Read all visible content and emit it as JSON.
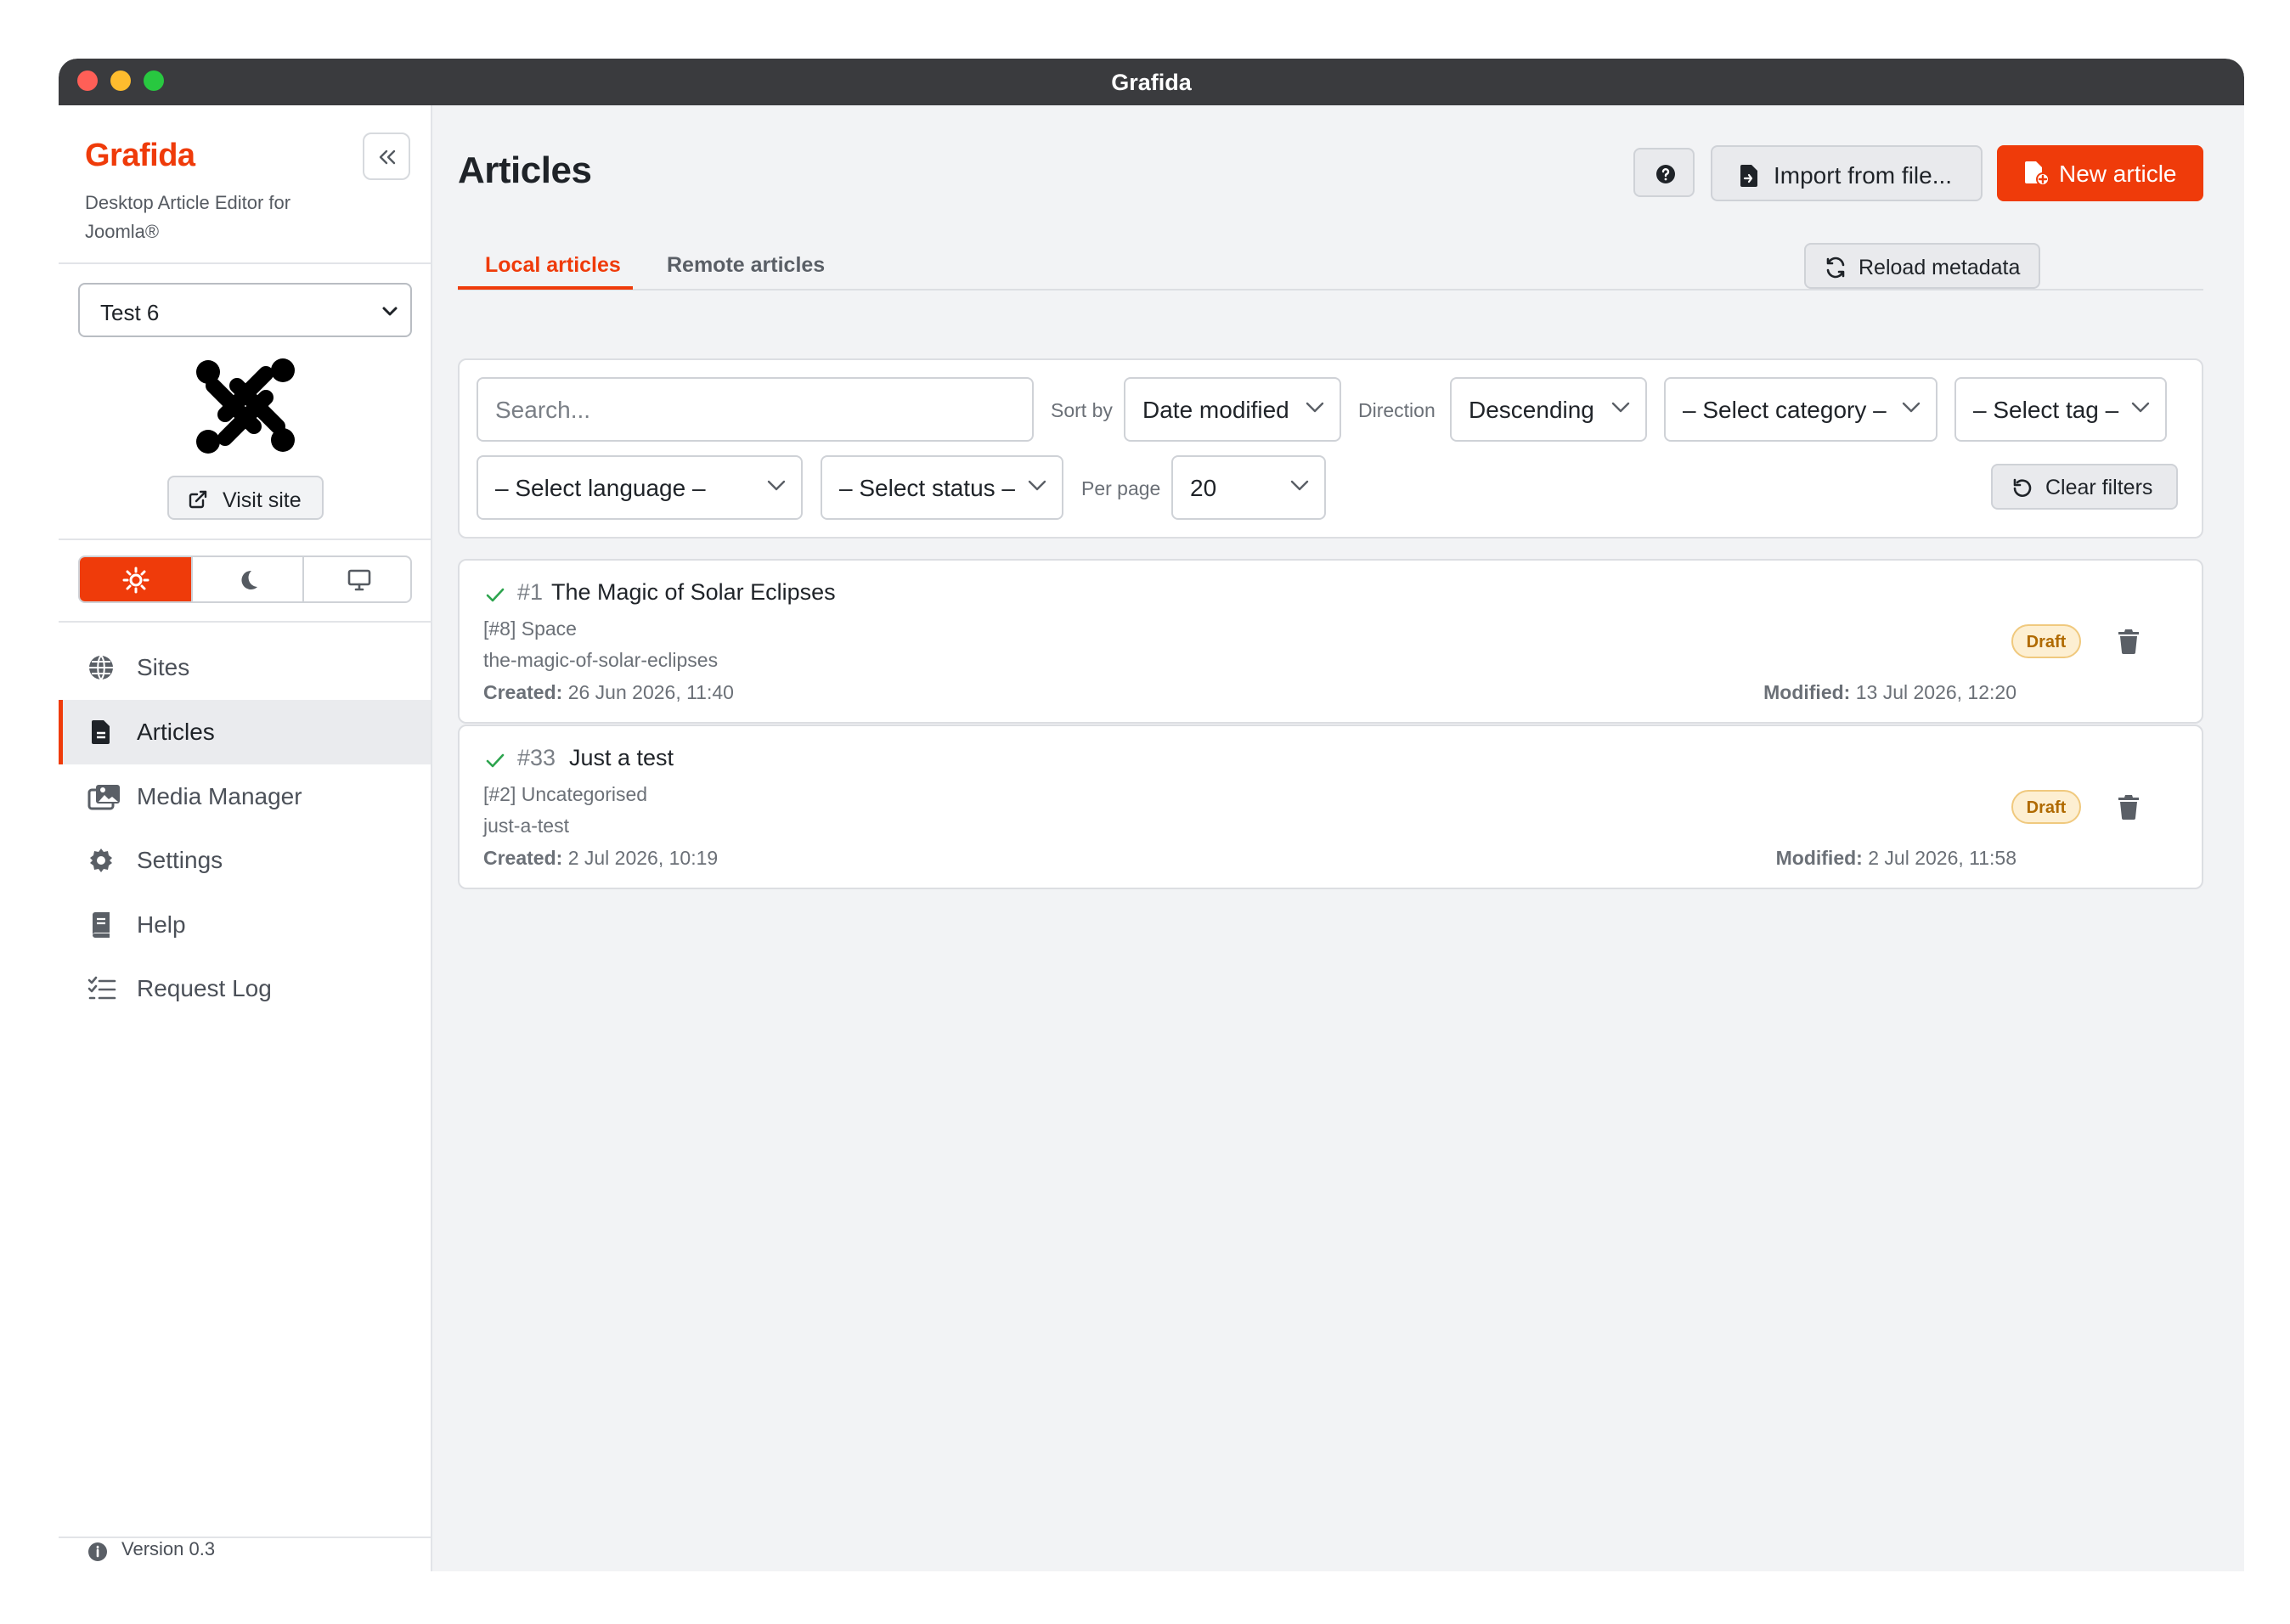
{
  "window": {
    "title": "Grafida"
  },
  "sidebar": {
    "brand": "Grafida",
    "tagline": "Desktop Article Editor for Joomla®",
    "site_select": {
      "value": "Test 6"
    },
    "visit_site_label": "Visit site",
    "theme": {
      "options": [
        "light",
        "dark",
        "system"
      ],
      "selected": "light"
    },
    "nav": [
      {
        "label": "Sites",
        "icon": "globe-icon"
      },
      {
        "label": "Articles",
        "icon": "document-icon",
        "active": true
      },
      {
        "label": "Media Manager",
        "icon": "images-icon"
      },
      {
        "label": "Settings",
        "icon": "gear-icon"
      },
      {
        "label": "Help",
        "icon": "book-icon"
      },
      {
        "label": "Request Log",
        "icon": "list-check-icon"
      }
    ],
    "version": "Version 0.3"
  },
  "main": {
    "title": "Articles",
    "import_label": "Import from file...",
    "new_label": "New article",
    "tabs": [
      {
        "label": "Local articles",
        "active": true
      },
      {
        "label": "Remote articles",
        "active": false
      }
    ],
    "reload_label": "Reload metadata",
    "filters": {
      "search_placeholder": "Search...",
      "sort_by_label": "Sort by",
      "sort_by_value": "Date modified",
      "direction_label": "Direction",
      "direction_value": "Descending",
      "category_value": "– Select category –",
      "tag_value": "– Select tag –",
      "language_value": "– Select language –",
      "status_value": "– Select status –",
      "per_page_label": "Per page",
      "per_page_value": "20",
      "clear_label": "Clear filters"
    },
    "articles": [
      {
        "id": "#1",
        "title": "The Magic of Solar Eclipses",
        "category": "[#8] Space",
        "alias": "the-magic-of-solar-eclipses",
        "created_label": "Created:",
        "created": "26 Jun 2026, 11:40",
        "modified_label": "Modified:",
        "modified": "13 Jul 2026, 12:20",
        "status": "Draft"
      },
      {
        "id": "#33",
        "title": "Just a test",
        "category": "[#2] Uncategorised",
        "alias": "just-a-test",
        "created_label": "Created:",
        "created": "2 Jul 2026, 10:19",
        "modified_label": "Modified:",
        "modified": "2 Jul 2026, 11:58",
        "status": "Draft"
      }
    ]
  },
  "colors": {
    "accent": "#ef3b0a",
    "draft_badge_bg": "#fdefd2",
    "draft_badge_text": "#b06a00",
    "published_check": "#2da44e"
  }
}
